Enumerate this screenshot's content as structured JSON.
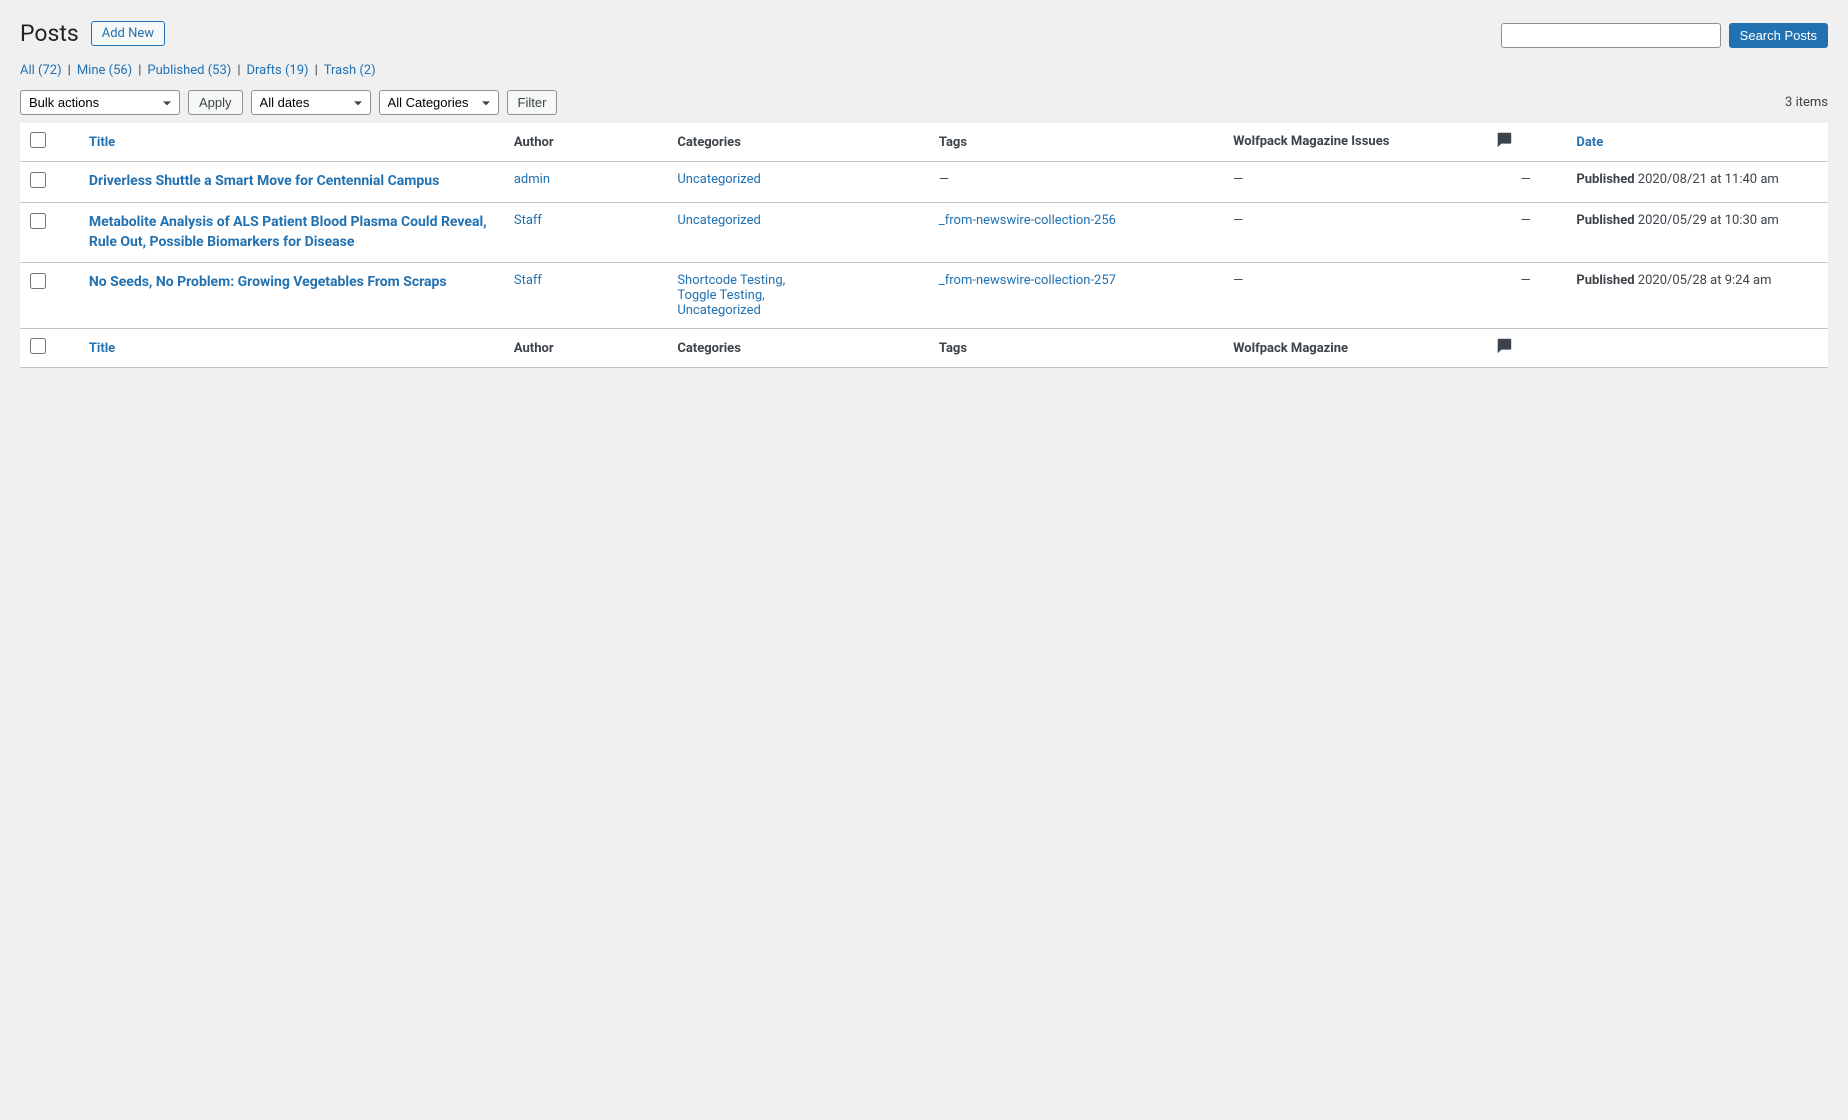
{
  "header": {
    "title": "Posts",
    "add_new_label": "Add New"
  },
  "nav": {
    "items": [
      {
        "label": "All",
        "count": "72",
        "href": "#"
      },
      {
        "label": "Mine",
        "count": "56",
        "href": "#"
      },
      {
        "label": "Published",
        "count": "53",
        "href": "#"
      },
      {
        "label": "Drafts",
        "count": "19",
        "href": "#"
      },
      {
        "label": "Trash",
        "count": "2",
        "href": "#"
      }
    ]
  },
  "search": {
    "placeholder": "",
    "button_label": "Search Posts"
  },
  "actions": {
    "bulk_actions_label": "Bulk actions",
    "apply_label": "Apply",
    "dates_label": "All dates",
    "categories_label": "All Categories",
    "filter_label": "Filter",
    "items_count": "3 items"
  },
  "table": {
    "columns": {
      "title": "Title",
      "author": "Author",
      "categories": "Categories",
      "tags": "Tags",
      "wolfpack": "Wolfpack Magazine Issues",
      "date": "Date"
    },
    "rows": [
      {
        "id": "row1",
        "title": "Driverless Shuttle a Smart Move for Centennial Campus",
        "author": "admin",
        "categories": [
          "Uncategorized"
        ],
        "tags": [
          "—"
        ],
        "wolfpack": "—",
        "comments": "—",
        "date_status": "Published",
        "date_value": "2020/08/21 at 11:40 am"
      },
      {
        "id": "row2",
        "title": "Metabolite Analysis of ALS Patient Blood Plasma Could Reveal, Rule Out, Possible Biomarkers for Disease",
        "author": "Staff",
        "categories": [
          "Uncategorized"
        ],
        "tags": [
          "_from-newswire-collection-256"
        ],
        "wolfpack": "—",
        "comments": "—",
        "date_status": "Published",
        "date_value": "2020/05/29 at 10:30 am"
      },
      {
        "id": "row3",
        "title": "No Seeds, No Problem: Growing Vegetables From Scraps",
        "author": "Staff",
        "categories": [
          "Shortcode Testing,",
          "Toggle Testing,",
          "Uncategorized"
        ],
        "tags": [
          "_from-newswire-collection-257"
        ],
        "wolfpack": "—",
        "comments": "—",
        "date_status": "Published",
        "date_value": "2020/05/28 at 9:24 am"
      }
    ],
    "footer_columns": {
      "title": "Title",
      "author": "Author",
      "categories": "Categories",
      "tags": "Tags",
      "wolfpack": "Wolfpack Magazine"
    }
  }
}
